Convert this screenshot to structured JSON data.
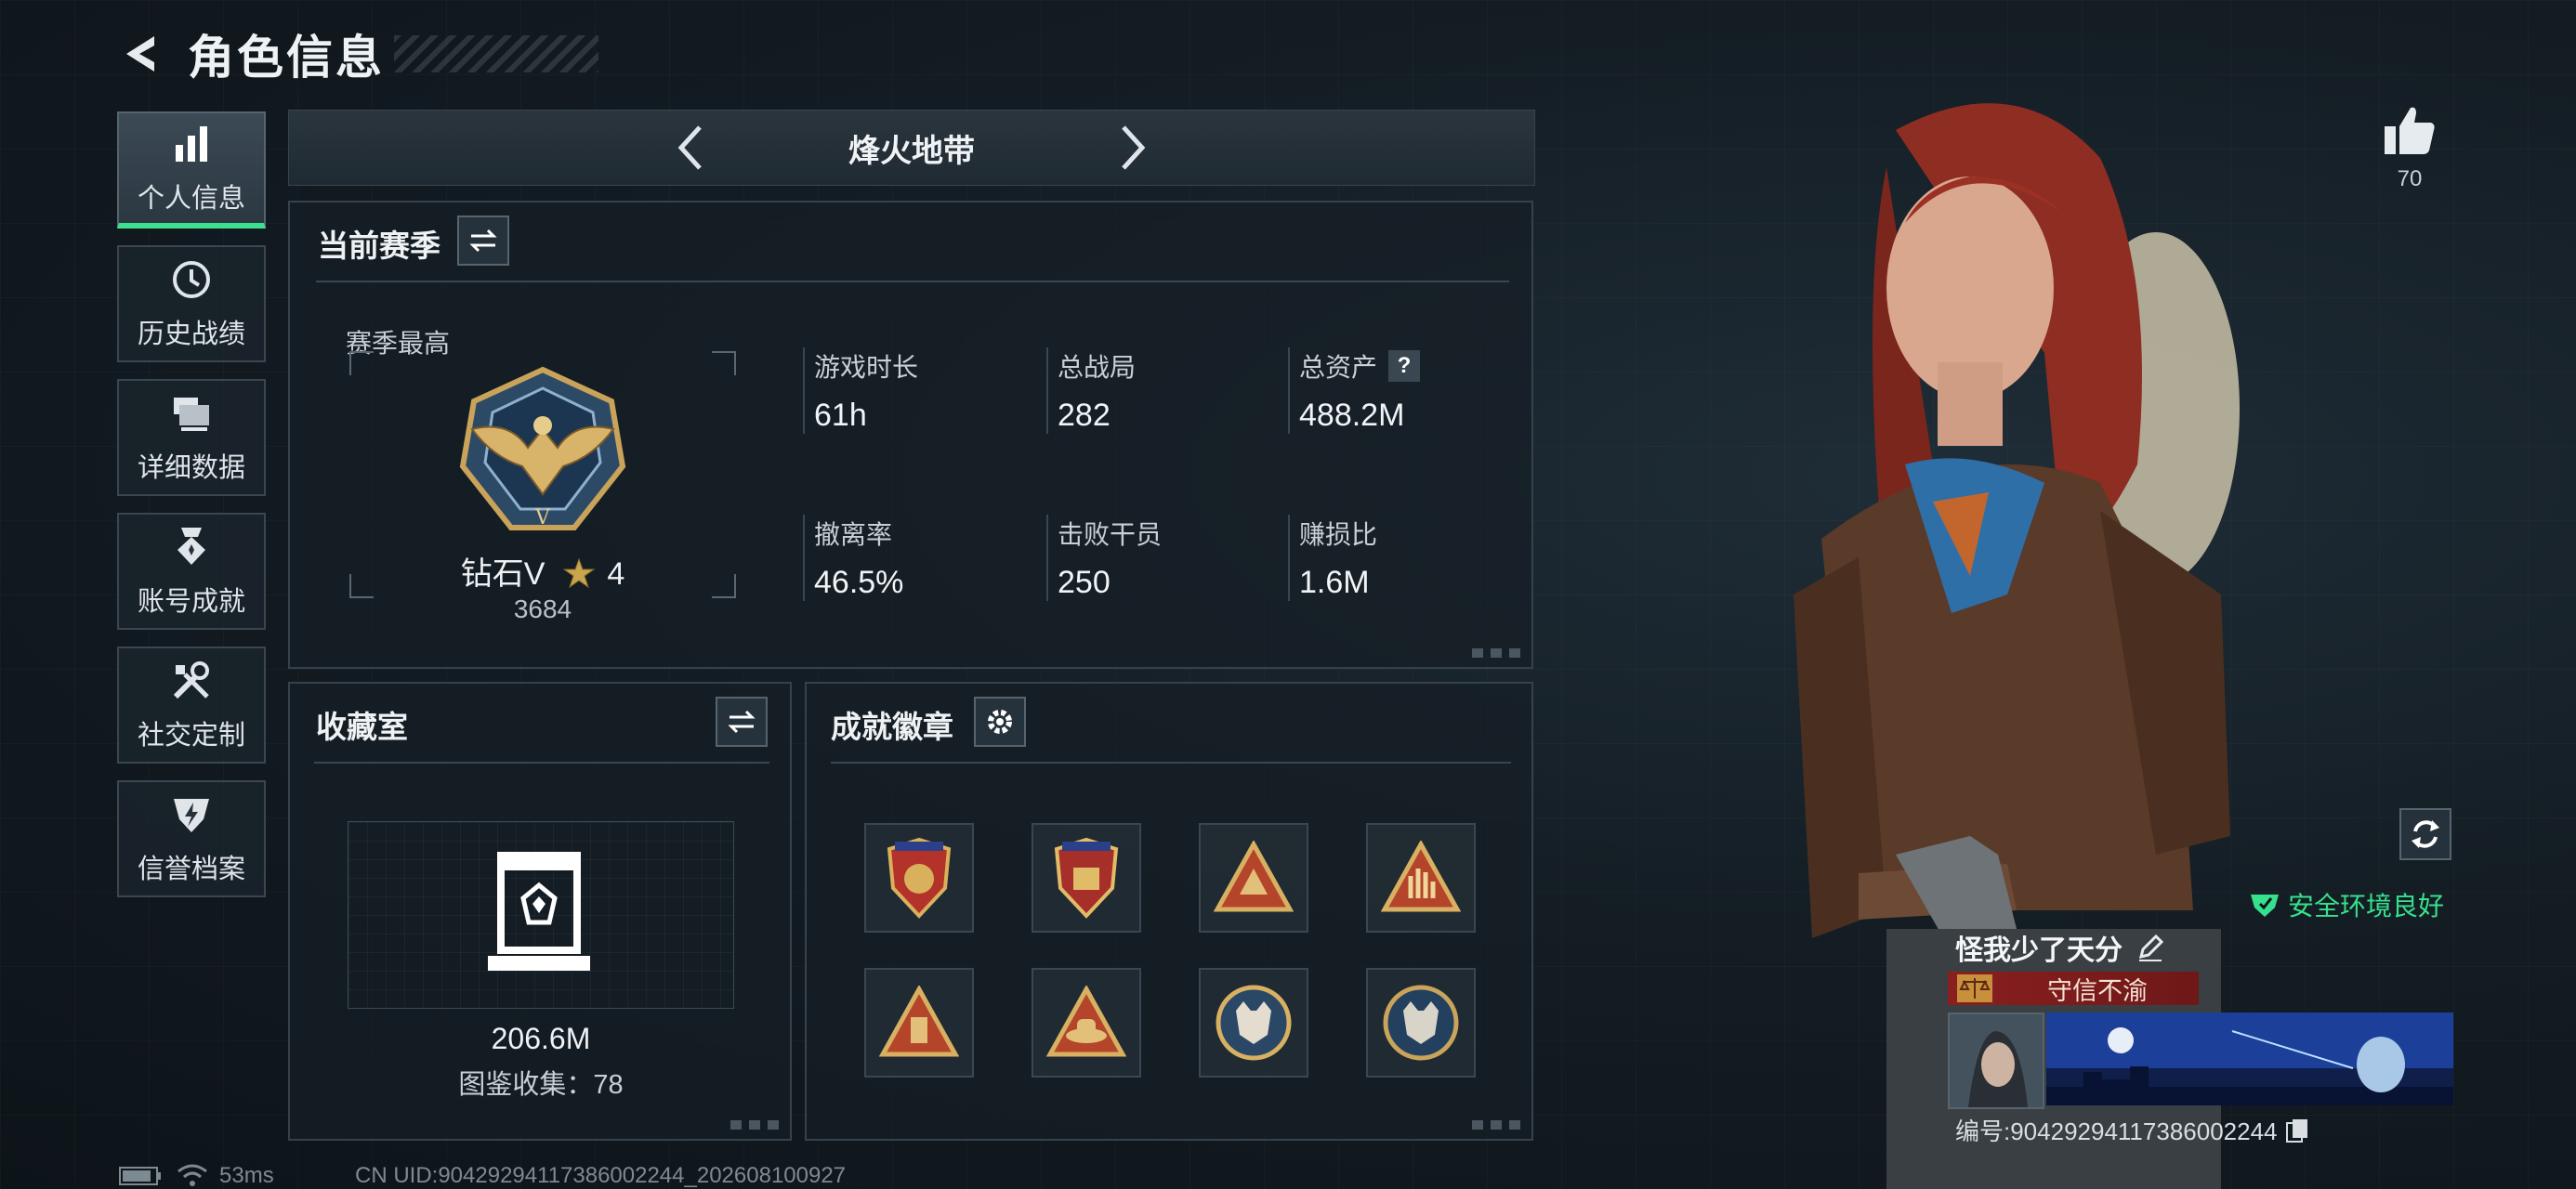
{
  "header": {
    "title": "角色信息",
    "back_icon": "back-arrow-icon"
  },
  "nav": {
    "items": [
      {
        "label": "个人信息",
        "icon": "bar-chart-icon",
        "active": true
      },
      {
        "label": "历史战绩",
        "icon": "history-clock-icon",
        "active": false
      },
      {
        "label": "详细数据",
        "icon": "folder-icon",
        "active": false
      },
      {
        "label": "账号成就",
        "icon": "achievement-medal-icon",
        "active": false
      },
      {
        "label": "社交定制",
        "icon": "wrench-screwdriver-icon",
        "active": false
      },
      {
        "label": "信誉档案",
        "icon": "shield-lightning-icon",
        "active": false
      }
    ]
  },
  "map": {
    "name": "烽火地带"
  },
  "season": {
    "title": "当前赛季",
    "best_label": "赛季最高",
    "rank_name": "钻石V",
    "rank_stars": "4",
    "rank_score": "3684",
    "stats": [
      {
        "label": "游戏时长",
        "value": "61h"
      },
      {
        "label": "总战局",
        "value": "282"
      },
      {
        "label": "总资产",
        "value": "488.2M",
        "help": "?"
      },
      {
        "label": "撤离率",
        "value": "46.5%"
      },
      {
        "label": "击败干员",
        "value": "250"
      },
      {
        "label": "赚损比",
        "value": "1.6M"
      }
    ]
  },
  "collection": {
    "title": "收藏室",
    "value": "206.6M",
    "count_label": "图鉴收集：78"
  },
  "achievements": {
    "title": "成就徽章",
    "badges": [
      "shield-badge-red",
      "shield-badge-gold",
      "triangle-badge-gold",
      "triangle-badge-hand",
      "triangle-badge-flag",
      "triangle-badge-hat",
      "circle-badge-wolf",
      "circle-badge-wolf-blue"
    ]
  },
  "status": {
    "ping": "53ms",
    "uid": "CN UID:90429294117386002244_202608100927"
  },
  "player": {
    "likes": "70",
    "env_status": "安全环境良好",
    "name": "怪我少了天分",
    "honor": "守信不渝",
    "id_label": "编号:90429294117386002244"
  },
  "colors": {
    "accent_green": "#3ee08f",
    "honor_red": "#8a1f1f"
  }
}
